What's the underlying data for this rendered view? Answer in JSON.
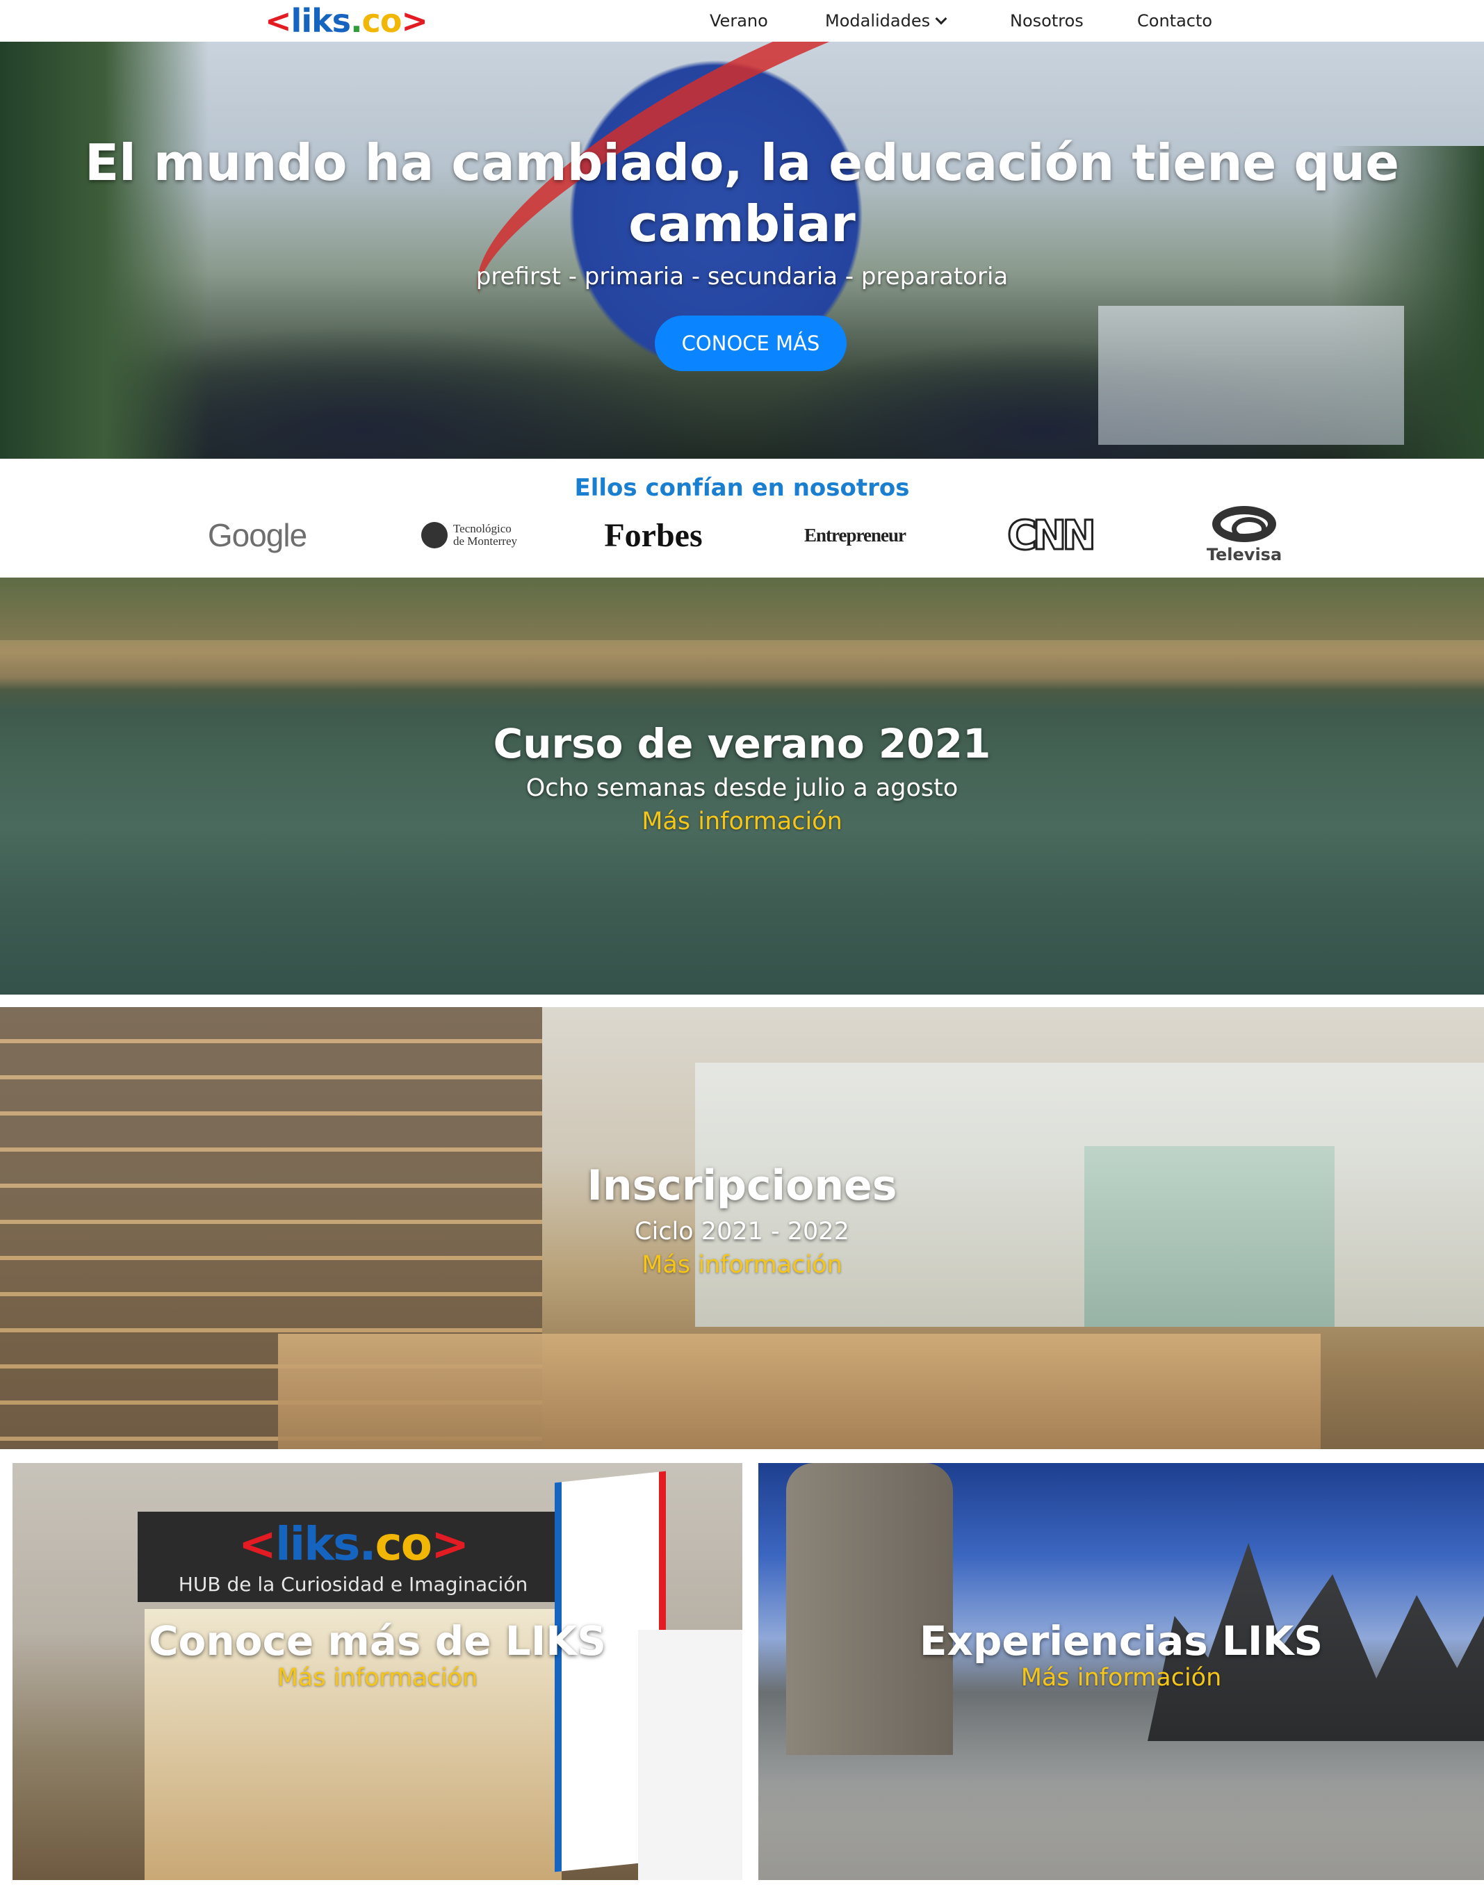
{
  "header": {
    "logo": {
      "bracket_left": "<",
      "name": "liks",
      "dot": ".",
      "tld": "co",
      "bracket_right": ">"
    },
    "nav": [
      {
        "label": "Verano"
      },
      {
        "label": "Modalidades"
      },
      {
        "label": "Nosotros"
      },
      {
        "label": "Contacto"
      }
    ]
  },
  "hero": {
    "title": "El mundo ha cambiado, la educación tiene que cambiar",
    "subtitle": "prefirst - primaria - secundaria - preparatoria",
    "button_label": "CONOCE MÁS"
  },
  "trust": {
    "title": "Ellos confían en nosotros",
    "brands": {
      "google": "Google",
      "tec_line1": "Tecnológico",
      "tec_line2": "de Monterrey",
      "forbes": "Forbes",
      "entrepreneur": "Entrepreneur",
      "cnn": "CNN",
      "televisa": "Televisa"
    }
  },
  "panels": {
    "verano": {
      "title": "Curso de verano 2021",
      "subtitle": "Ocho semanas desde julio a agosto",
      "link": "Más información"
    },
    "inscripciones": {
      "title": "Inscripciones",
      "subtitle": "Ciclo 2021 - 2022",
      "link": "Más información"
    },
    "conoce": {
      "title": "Conoce más de LIKS",
      "link": "Más información",
      "store_sign_hub": "HUB de la Curiosidad e Imaginación"
    },
    "experiencias": {
      "title": "Experiencias LIKS",
      "link": "Más información"
    }
  },
  "colors": {
    "brand_blue": "#1565c0",
    "brand_red": "#e31b23",
    "brand_yellow": "#f2b705",
    "brand_green": "#2e9d3a",
    "cta_blue": "#0a84ff",
    "link_yellow": "#f5c518",
    "trust_title_blue": "#1a7fd0"
  }
}
